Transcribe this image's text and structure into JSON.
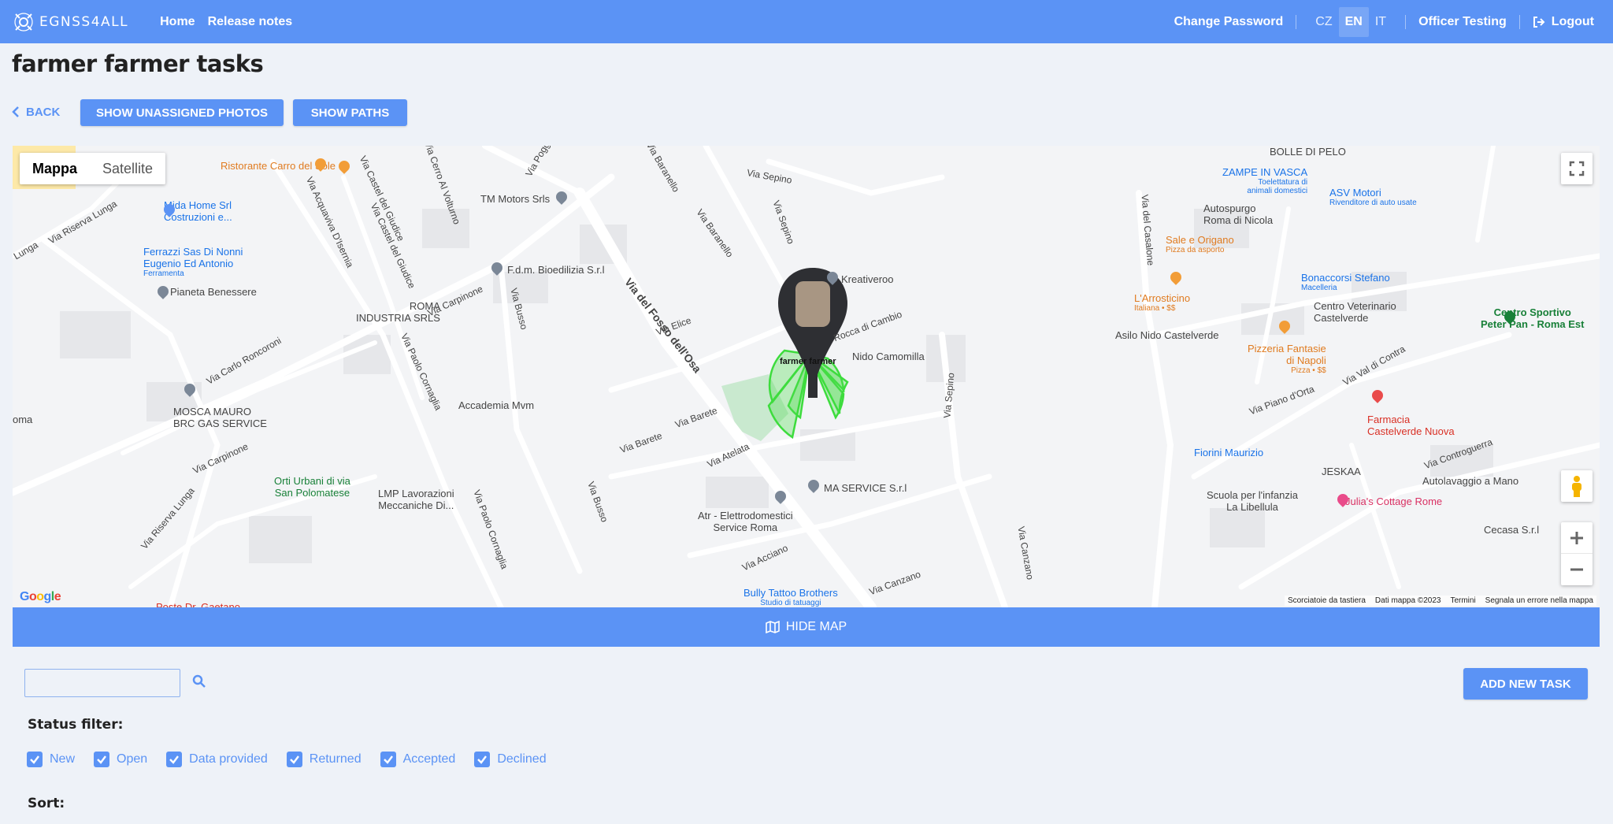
{
  "navbar": {
    "logo_text": "EGNSS4ALL",
    "links": [
      "Home",
      "Release notes"
    ],
    "change_password": "Change Password",
    "languages": [
      "CZ",
      "EN",
      "IT"
    ],
    "active_language": "EN",
    "user": "Officer Testing",
    "logout": "Logout"
  },
  "page": {
    "title": "farmer farmer tasks",
    "back": "BACK",
    "show_unassigned": "SHOW UNASSIGNED PHOTOS",
    "show_paths": "SHOW PATHS"
  },
  "map": {
    "type_options": [
      "Mappa",
      "Satellite"
    ],
    "active_type": "Mappa",
    "google": "Google",
    "footer": [
      "Scorciatoie da tastiera",
      "Dati mappa ©2023",
      "Termini",
      "Segnala un errore nella mappa"
    ],
    "pois": {
      "ristorante": "Ristorante Carro del Sole",
      "mida": "Mida Home Srl",
      "mida2": "Costruzioni e...",
      "ferrazzi": "Ferrazzi Sas Di Nonni",
      "ferrazzi2": "Eugenio Ed Antonio",
      "ferrazzi3": "Ferramenta",
      "pianeta": "Pianeta Benessere",
      "roma": "ROMA",
      "roma2": "INDUSTRIA SRLS",
      "tm": "TM Motors Srls",
      "fdm": "F.d.m. Bioedilizia S.r.l",
      "mosca": "MOSCA MAURO",
      "mosca2": "BRC GAS SERVICE",
      "accademia": "Accademia Mvm",
      "orti": "Orti Urbani di via",
      "orti2": "San Polomatese",
      "lmp": "LMP Lavorazioni",
      "lmp2": "Meccaniche Di...",
      "kreativeroo": "Kreativeroo",
      "nido": "Nido Camomilla",
      "ma": "MA SERVICE S.r.l",
      "atr": "Atr - Elettrodomestici",
      "atr2": "Service Roma",
      "bully": "Bully Tattoo Brothers",
      "bully2": "Studio di tatuaggi",
      "bolle": "BOLLE DI PELO",
      "zampe": "ZAMPE IN VASCA",
      "zampe2": "Toelettatura di",
      "zampe3": "animali domestici",
      "asv": "ASV Motori",
      "asv2": "Rivenditore di auto usate",
      "autospurgo": "Autospurgo",
      "autospurgo2": "Roma di Nicola",
      "sale": "Sale e Origano",
      "sale2": "Pizza da asporto",
      "bonaccorsi": "Bonaccorsi Stefano",
      "bonaccorsi2": "Macelleria",
      "arrosticino": "L'Arrosticino",
      "arrosticino2": "Italiana • $$",
      "centro_vet": "Centro Veterinario",
      "centro_vet2": "Castelverde",
      "asilo": "Asilo Nido Castelverde",
      "pizzeria": "Pizzeria Fantasie",
      "pizzeria2": "di Napoli",
      "pizzeria3": "Pizza • $$",
      "sportivo": "Centro Sportivo",
      "sportivo2": "Peter Pan - Roma Est",
      "farmacia": "Farmacia",
      "farmacia2": "Castelverde Nuova",
      "fiorini": "Fiorini Maurizio",
      "jeskaa": "JESKAA",
      "autolavaggio": "Autolavaggio a Mano",
      "scuola": "Scuola per l'infanzia",
      "scuola2": "La Libellula",
      "julia": "Julia's Cottage Rome",
      "cecasa": "Cecasa S.r.l",
      "posta": "Poste Dr. Gaetano"
    },
    "streets": {
      "fosso": "Via del Fosso dell'Osa",
      "casalone": "Via del Casalone",
      "sepino": "Via Sepino",
      "sepino2": "Via Sepino",
      "sepino3": "Via Sepino",
      "baranello": "Via Baranello",
      "baranello2": "Via Baranello",
      "carpinone": "Via Carpinone",
      "carpinone2": "Via Carpinone",
      "busso": "Via Busso",
      "busso2": "Via Busso",
      "cornaglia": "Via Paolo Cornaglia",
      "cornaglia2": "Via Paolo Cornaglia",
      "roncorroni": "Via Carlo Roncoroni",
      "riserva": "Via Riserva Lunga",
      "riserva2": "Via Riserva Lunga",
      "acquaviva": "Via Acquaviva D'Isernia",
      "castel": "Via Castel del Giudice",
      "castel2": "Via Castel del Giudice",
      "cerro": "Via Cerro Al Volturno",
      "elice": "Via Elice",
      "barete": "Via Barete",
      "barete2": "Via Barete",
      "atelata": "Via Atelata",
      "acciano": "Via Acciano",
      "canzano": "Via Canzano",
      "canzano2": "Via Canzano",
      "cambio": "Rocca di Cambio",
      "piano": "Via Piano d'Orta",
      "contra": "Via Val di Contra",
      "controguerra": "Via Controguerra",
      "poggio": "Via Poggio",
      "oma": "oma",
      "lunga": "Lunga"
    },
    "marker_text": "farmer farmer"
  },
  "hide_map": "HIDE MAP",
  "search": {
    "value": "",
    "placeholder": ""
  },
  "add_new_task": "ADD NEW TASK",
  "status_filter": {
    "label": "Status filter:",
    "options": [
      "New",
      "Open",
      "Data provided",
      "Returned",
      "Accepted",
      "Declined"
    ]
  },
  "sort": {
    "label": "Sort:"
  },
  "colors": {
    "primary": "#5b93f5",
    "marker_green": "#3ddc3d"
  }
}
